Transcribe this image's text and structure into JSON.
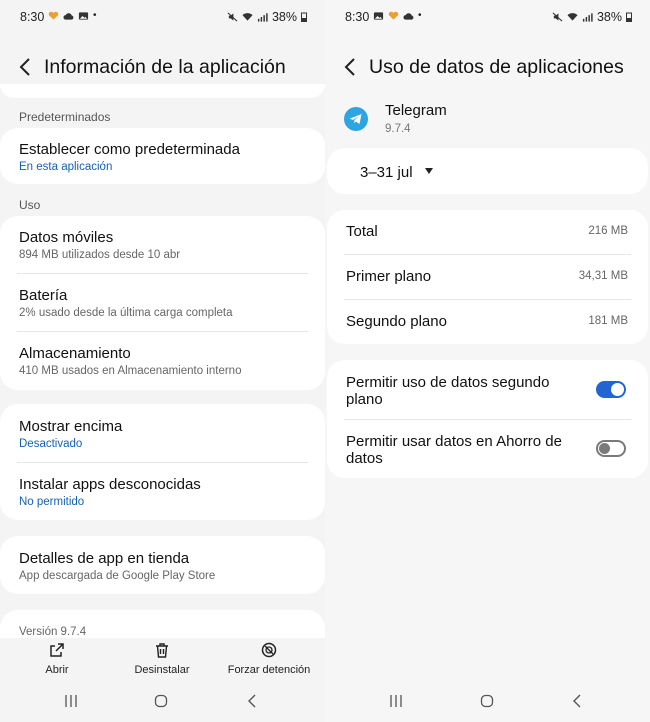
{
  "left": {
    "status": {
      "time": "8:30",
      "battery": "38%"
    },
    "header": {
      "title": "Información de la aplicación"
    },
    "sections": {
      "defaults_label": "Predeterminados",
      "usage_label": "Uso"
    },
    "set_default": {
      "title": "Establecer como predeterminada",
      "subtitle": "En esta aplicación"
    },
    "mobile_data": {
      "title": "Datos móviles",
      "subtitle": "894 MB utilizados desde 10 abr"
    },
    "battery": {
      "title": "Batería",
      "subtitle": "2% usado desde la última carga completa"
    },
    "storage": {
      "title": "Almacenamiento",
      "subtitle": "410 MB usados en Almacenamiento interno"
    },
    "show_on_top": {
      "title": "Mostrar encima",
      "subtitle": "Desactivado"
    },
    "install_unknown": {
      "title": "Instalar apps desconocidas",
      "subtitle": "No permitido"
    },
    "store_details": {
      "title": "Detalles de app en tienda",
      "subtitle": "App descargada de Google Play Store"
    },
    "version": "Versión 9.7.4",
    "actions": {
      "open": "Abrir",
      "uninstall": "Desinstalar",
      "force_stop": "Forzar detención"
    }
  },
  "right": {
    "status": {
      "time": "8:30",
      "battery": "38%"
    },
    "header": {
      "title": "Uso de datos de aplicaciones"
    },
    "app": {
      "name": "Telegram",
      "version": "9.7.4"
    },
    "date_range": "3–31 jul",
    "usage": [
      {
        "label": "Total",
        "value": "216 MB"
      },
      {
        "label": "Primer plano",
        "value": "34,31 MB"
      },
      {
        "label": "Segundo plano",
        "value": "181 MB"
      }
    ],
    "toggles": [
      {
        "label": "Permitir uso de datos segundo plano",
        "on": true
      },
      {
        "label": "Permitir usar datos en Ahorro de datos",
        "on": false
      }
    ]
  },
  "colors": {
    "accent": "#2264d1",
    "link_blue": "#1560b6",
    "telegram_blue": "#2ca5e0"
  }
}
